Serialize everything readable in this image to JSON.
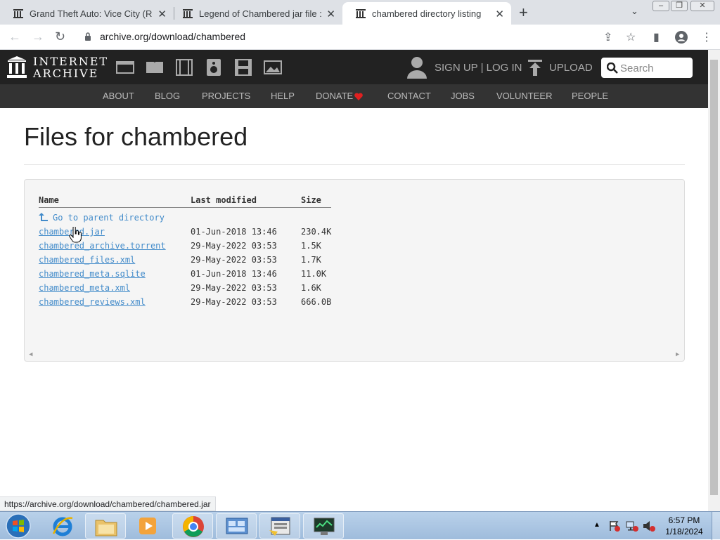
{
  "browser": {
    "tabs": [
      {
        "title": "Grand Theft Auto: Vice City (Reta",
        "active": false
      },
      {
        "title": "Legend of Chambered jar file : N",
        "active": false
      },
      {
        "title": "chambered directory listing",
        "active": true
      }
    ],
    "url": "archive.org/download/chambered",
    "status_url": "https://archive.org/download/chambered/chambered.jar"
  },
  "ia_header": {
    "logo_line1": "INTERNET",
    "logo_line2": "ARCHIVE",
    "signup_label": "SIGN UP | LOG IN",
    "upload_label": "UPLOAD",
    "search_placeholder": "Search",
    "nav": [
      "ABOUT",
      "BLOG",
      "PROJECTS",
      "HELP",
      "DONATE",
      "CONTACT",
      "JOBS",
      "VOLUNTEER",
      "PEOPLE"
    ]
  },
  "page": {
    "title": "Files for chambered",
    "columns": {
      "name": "Name",
      "modified": "Last modified",
      "size": "Size"
    },
    "parent_link": "Go to parent directory",
    "files": [
      {
        "name": "chambered.jar",
        "modified": "01-Jun-2018 13:46",
        "size": "230.4K"
      },
      {
        "name": "chambered_archive.torrent",
        "modified": "29-May-2022 03:53",
        "size": "1.5K"
      },
      {
        "name": "chambered_files.xml",
        "modified": "29-May-2022 03:53",
        "size": "1.7K"
      },
      {
        "name": "chambered_meta.sqlite",
        "modified": "01-Jun-2018 13:46",
        "size": "11.0K"
      },
      {
        "name": "chambered_meta.xml",
        "modified": "29-May-2022 03:53",
        "size": "1.6K"
      },
      {
        "name": "chambered_reviews.xml",
        "modified": "29-May-2022 03:53",
        "size": "666.0B"
      }
    ]
  },
  "taskbar": {
    "time": "6:57 PM",
    "date": "1/18/2024"
  },
  "colors": {
    "link": "#428bca",
    "donate_heart": "#e02020",
    "ia_dark": "#222222"
  }
}
